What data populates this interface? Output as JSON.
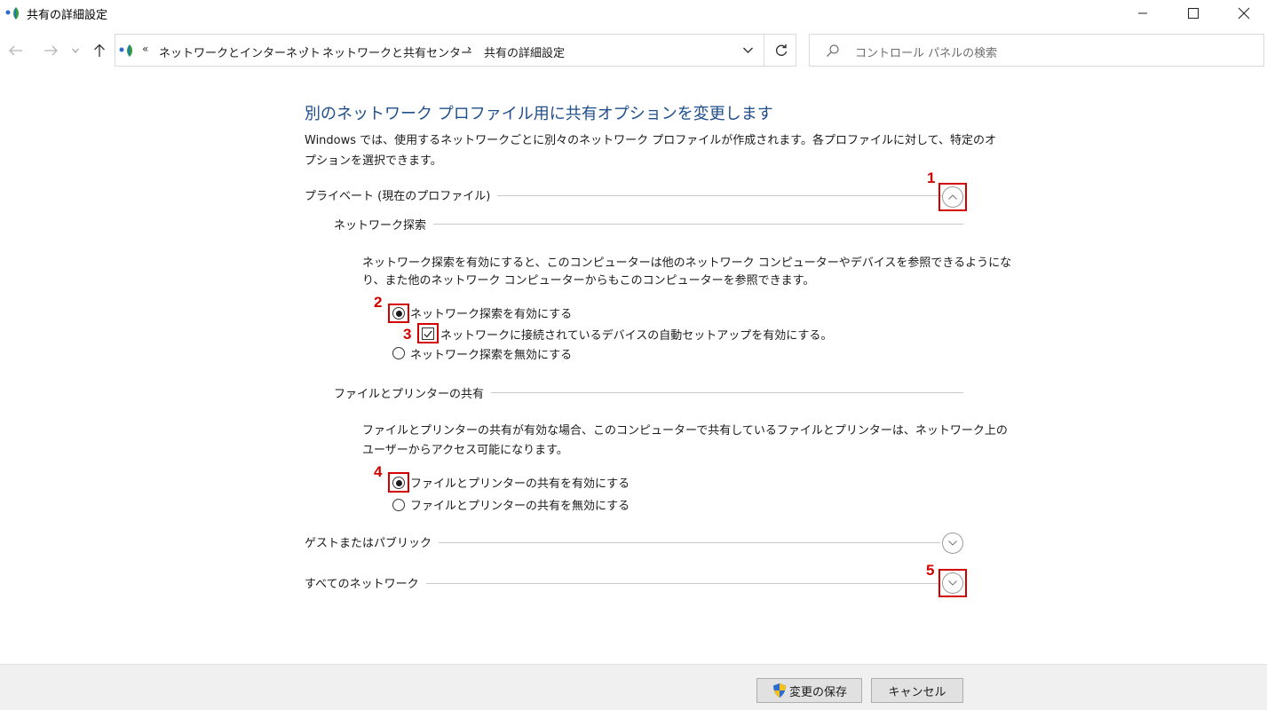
{
  "window": {
    "title": "共有の詳細設定"
  },
  "address": {
    "overflow": "«",
    "crumbs": [
      "ネットワークとインターネット",
      "ネットワークと共有センター",
      "共有の詳細設定"
    ],
    "separator": "›"
  },
  "search": {
    "placeholder": "コントロール パネルの検索"
  },
  "page": {
    "heading": "別のネットワーク プロファイル用に共有オプションを変更します",
    "intro_1": "Windows では、使用するネットワークごとに別々のネットワーク プロファイルが作成されます。各プロファイルに対して、特定のオ",
    "intro_2": "プションを選択できます。"
  },
  "private": {
    "label": "プライベート (現在のプロファイル)",
    "expanded": true,
    "discovery": {
      "label": "ネットワーク探索",
      "desc_1": "ネットワーク探索を有効にすると、このコンピューターは他のネットワーク コンピューターやデバイスを参照できるようにな",
      "desc_2": "り、また他のネットワーク コンピューターからもこのコンピューターを参照できます。",
      "opt_on": "ネットワーク探索を有効にする",
      "opt_auto": "ネットワークに接続されているデバイスの自動セットアップを有効にする。",
      "opt_off": "ネットワーク探索を無効にする",
      "selected": "on",
      "auto_checked": true
    },
    "sharing": {
      "label": "ファイルとプリンターの共有",
      "desc_1": "ファイルとプリンターの共有が有効な場合、このコンピューターで共有しているファイルとプリンターは、ネットワーク上の",
      "desc_2": "ユーザーからアクセス可能になります。",
      "opt_on": "ファイルとプリンターの共有を有効にする",
      "opt_off": "ファイルとプリンターの共有を無効にする",
      "selected": "on"
    }
  },
  "guest": {
    "label": "ゲストまたはパブリック",
    "expanded": false
  },
  "all": {
    "label": "すべてのネットワーク",
    "expanded": false
  },
  "annotations": {
    "n1": "1",
    "n2": "2",
    "n3": "3",
    "n4": "4",
    "n5": "5"
  },
  "footer": {
    "save": "変更の保存",
    "cancel": "キャンセル"
  },
  "colors": {
    "heading": "#1e4e8c",
    "annotation": "#d40000",
    "footer_bg": "#f0f0f0"
  }
}
